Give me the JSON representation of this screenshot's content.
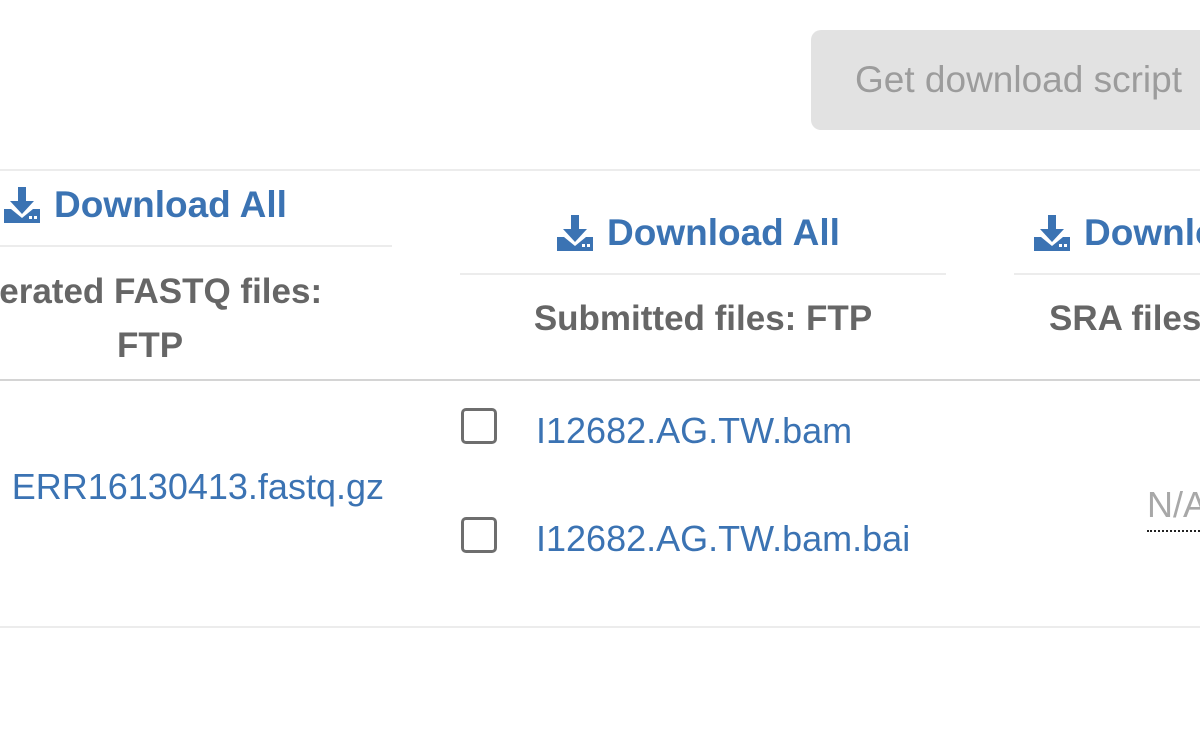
{
  "toolbar": {
    "download_script_label": "Get download script"
  },
  "columns": [
    {
      "download_all_label": "Download All",
      "header": "Generated FASTQ files: FTP",
      "header_visible_line1": "nerated FASTQ files:",
      "header_visible_line2": "FTP"
    },
    {
      "download_all_label": "Download All",
      "header": "Submitted files: FTP"
    },
    {
      "download_all_label": "Download All",
      "header": "SRA files"
    }
  ],
  "row": {
    "fastq_file": "ERR16130413.fastq.gz",
    "submitted_files": [
      {
        "name": "I12682.AG.TW.bam",
        "checked": false
      },
      {
        "name": "I12682.AG.TW.bam.bai",
        "checked": false
      }
    ],
    "sra_value": "N/A"
  },
  "colors": {
    "link": "#3b73b3",
    "header_text": "#666666",
    "button_bg": "#e2e2e2",
    "button_text": "#9c9c9c"
  },
  "icons": {
    "download": "download-icon",
    "checkbox": "checkbox-empty"
  }
}
